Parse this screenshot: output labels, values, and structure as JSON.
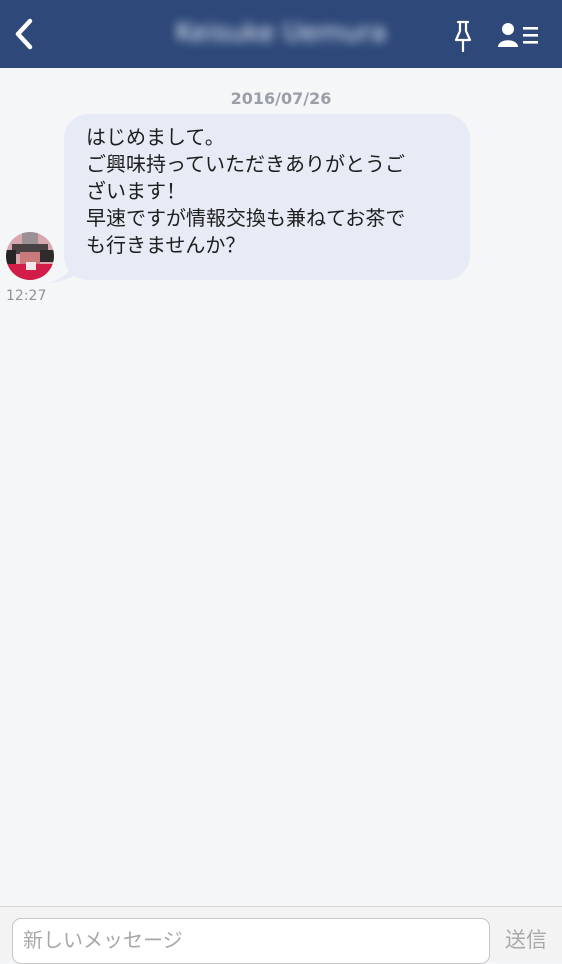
{
  "header": {
    "title": "Keisuke Uemura",
    "back_icon": "chevron-left-icon",
    "pin_icon": "pin-icon",
    "profile_icon": "profile-list-icon"
  },
  "chat": {
    "date": "2016/07/26",
    "messages": [
      {
        "time": "12:27",
        "lines": [
          "はじめまして。",
          "ご興味持っていただきありがとうご",
          "ざいます！",
          "早速ですが情報交換も兼ねてお茶で",
          "も行きませんか？"
        ]
      }
    ]
  },
  "composer": {
    "placeholder": "新しいメッセージ",
    "value": "",
    "send_label": "送信"
  },
  "colors": {
    "header_bg": "#2d4879",
    "bubble_bg": "#e6ebf5",
    "page_bg": "#f5f6f8"
  }
}
